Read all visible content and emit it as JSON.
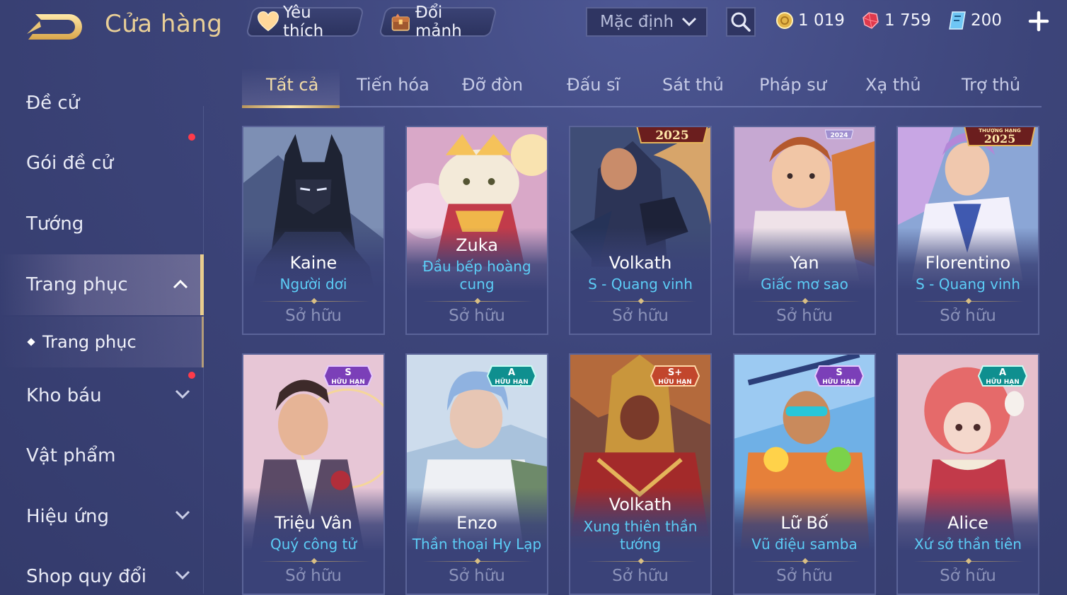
{
  "header": {
    "title": "Cửa hàng",
    "favorite_label": "Yêu thích",
    "exchange_label": "Đổi mảnh",
    "sort_label": "Mặc định",
    "currencies": {
      "gold": "1 019",
      "ruby": "1 759",
      "voucher": "200"
    }
  },
  "sidebar": {
    "items": [
      {
        "label": "Đề cử"
      },
      {
        "label": "Gói đề cử"
      },
      {
        "label": "Tướng"
      },
      {
        "label": "Trang phục"
      },
      {
        "label": "Kho báu"
      },
      {
        "label": "Vật phẩm"
      },
      {
        "label": "Hiệu ứng"
      },
      {
        "label": "Shop quy đổi"
      }
    ],
    "sub_item": "Trang phục"
  },
  "tabs": [
    "Tất cả",
    "Tiến hóa",
    "Đỡ đòn",
    "Đấu sĩ",
    "Sát thủ",
    "Pháp sư",
    "Xạ thủ",
    "Trợ thủ"
  ],
  "cards": [
    {
      "name": "Kaine",
      "skin": "Người dơi",
      "status": "Sở hữu"
    },
    {
      "name": "Zuka",
      "skin": "Đầu bếp hoàng cung",
      "status": "Sở hữu"
    },
    {
      "name": "Volkath",
      "skin": "S - Quang vinh",
      "status": "Sở hữu",
      "year_badge": "2025"
    },
    {
      "name": "Yan",
      "skin": "Giấc mơ sao",
      "status": "Sở hữu",
      "year_badge": "2024"
    },
    {
      "name": "Florentino",
      "skin": "S - Quang vinh",
      "status": "Sở hữu",
      "year_badge": "2025",
      "year_caption": "THƯỢNG HẠNG"
    },
    {
      "name": "Triệu Vân",
      "skin": "Quý công tử",
      "status": "Sở hữu",
      "tier": "S",
      "tier_caption": "HỮU HẠN"
    },
    {
      "name": "Enzo",
      "skin": "Thần thoại Hy Lạp",
      "status": "Sở hữu",
      "tier": "A",
      "tier_caption": "HỮU HẠN"
    },
    {
      "name": "Volkath",
      "skin": "Xung thiên thần tướng",
      "status": "Sở hữu",
      "tier": "S+",
      "tier_caption": "HỮU HẠN"
    },
    {
      "name": "Lữ Bố",
      "skin": "Vũ điệu samba",
      "status": "Sở hữu",
      "tier": "S",
      "tier_caption": "HỮU HẠN"
    },
    {
      "name": "Alice",
      "skin": "Xứ sở thần tiên",
      "status": "Sở hữu",
      "tier": "A",
      "tier_caption": "HỮU HẠN"
    }
  ],
  "colors": {
    "accent_gold": "#e9cf97",
    "skin_name_blue": "#5ccdf6",
    "notification_red": "#ff3b4a"
  }
}
